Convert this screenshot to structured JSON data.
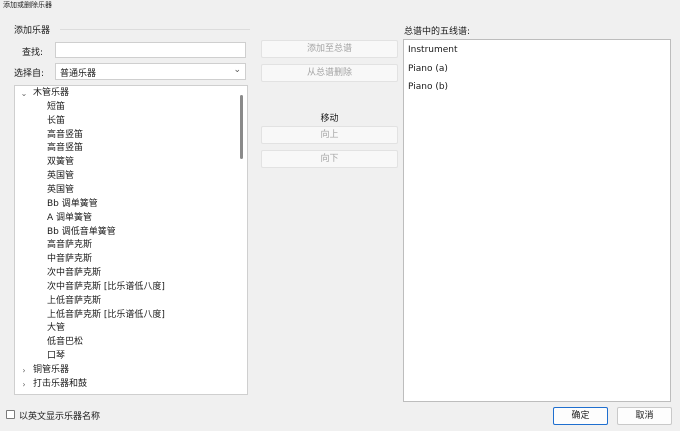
{
  "window": {
    "title": "添加或删除乐器"
  },
  "add_group": {
    "label": "添加乐器",
    "search_label": "查找:",
    "search_value": "",
    "from_label": "选择自:",
    "from_value": "普通乐器"
  },
  "tree": {
    "categories": [
      {
        "label": "木管乐器",
        "expanded": true,
        "items": [
          "短笛",
          "长笛",
          "高音竖笛",
          "高音竖笛",
          "双簧管",
          "英国管",
          "英国管",
          "Bb 调单簧管",
          "A 调单簧管",
          "Bb 调低音单簧管",
          "高音萨克斯",
          "中音萨克斯",
          "次中音萨克斯",
          "次中音萨克斯 [比乐谱低八度]",
          "上低音萨克斯",
          "上低音萨克斯 [比乐谱低八度]",
          "大管",
          "低音巴松",
          "口琴"
        ]
      },
      {
        "label": "铜管乐器",
        "expanded": false
      },
      {
        "label": "打击乐器和鼓",
        "expanded": false
      }
    ]
  },
  "actions": {
    "add_to_score": "添加至总谱",
    "remove_from_score": "从总谱删除",
    "move_label": "移动",
    "up": "向上",
    "down": "向下"
  },
  "score": {
    "label": "总谱中的五线谱:",
    "items": [
      "Instrument",
      "Piano (a)",
      "Piano (b)"
    ]
  },
  "footer": {
    "show_english_label": "以英文显示乐器名称",
    "show_english_checked": false,
    "ok": "确定",
    "cancel": "取消"
  },
  "colors": {
    "ok_border": "#1f6fcf",
    "disabled_text": "#a3a3a3"
  }
}
